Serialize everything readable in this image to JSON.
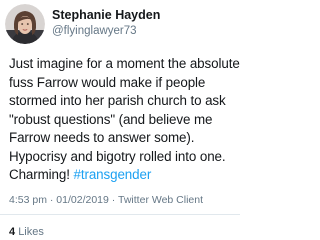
{
  "author": {
    "display_name": "Stephanie Hayden",
    "handle": "@flyinglawyer73"
  },
  "tweet": {
    "lines": [
      "Just imagine for a moment the absolute",
      "fuss Farrow would make if people",
      "stormed into her parish church to ask",
      "\"robust questions\" (and believe me",
      "Farrow needs to answer some).",
      "Hypocrisy and bigotry rolled into one."
    ],
    "last_line_text": "Charming! ",
    "hashtag": "#transgender"
  },
  "meta": {
    "time": "4:53 pm",
    "separator": "·",
    "date": "01/02/2019",
    "client": "Twitter Web Client"
  },
  "engagement": {
    "likes_count": "4",
    "likes_label": "Likes"
  },
  "colors": {
    "text": "#14171a",
    "secondary": "#657786",
    "link": "#1da1f2",
    "divider": "#e1e8ed"
  },
  "icons": {
    "avatar": "profile-photo"
  }
}
